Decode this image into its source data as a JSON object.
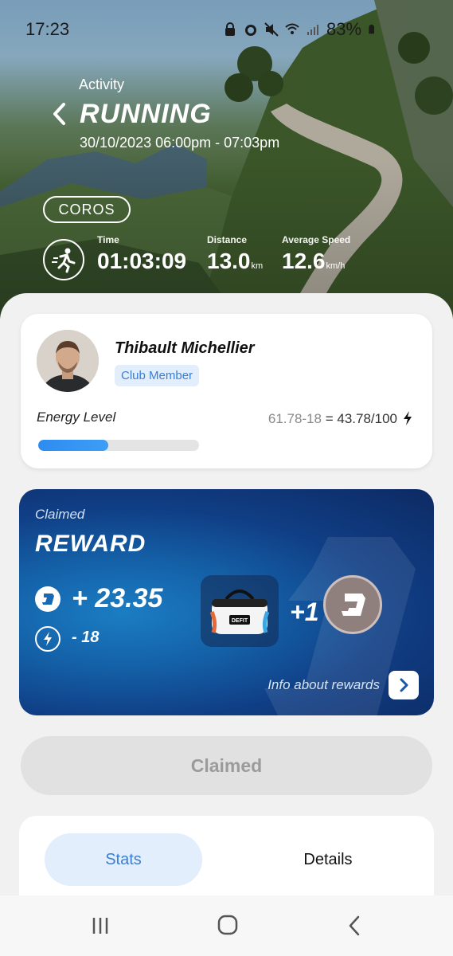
{
  "status_bar": {
    "time": "17:23",
    "battery": "83%",
    "icons": [
      "lock-icon",
      "alarm-icon",
      "mute-icon",
      "wifi-icon",
      "signal-icon",
      "battery-icon"
    ]
  },
  "header": {
    "section_label": "Activity",
    "title": "RUNNING",
    "date_range": "30/10/2023 06:00pm - 07:03pm",
    "device": "COROS"
  },
  "stats": {
    "time": {
      "label": "Time",
      "value": "01:03:09",
      "unit": ""
    },
    "distance": {
      "label": "Distance",
      "value": "13.0",
      "unit": "km"
    },
    "speed": {
      "label": "Average Speed",
      "value": "12.6",
      "unit": "km/h"
    }
  },
  "profile": {
    "name": "Thibault Michellier",
    "badge": "Club Member",
    "energy_label": "Energy Level",
    "energy_calc": "61.78-18",
    "energy_result": "= 43.78/100",
    "energy_fraction": 0.4378
  },
  "reward": {
    "status": "Claimed",
    "title": "REWARD",
    "coins": "+ 23.35",
    "energy_cost": "- 18",
    "item_bonus": "+1",
    "bag_brand": "DEFIT",
    "info_link": "Info about rewards"
  },
  "claim_button": {
    "label": "Claimed"
  },
  "tabs": {
    "stats": "Stats",
    "details": "Details"
  },
  "colors": {
    "accent": "#3b7ed2",
    "energy_bar": "#2d8cf0",
    "reward_bg": "#103e85",
    "badge_bg": "#e2eefb"
  }
}
